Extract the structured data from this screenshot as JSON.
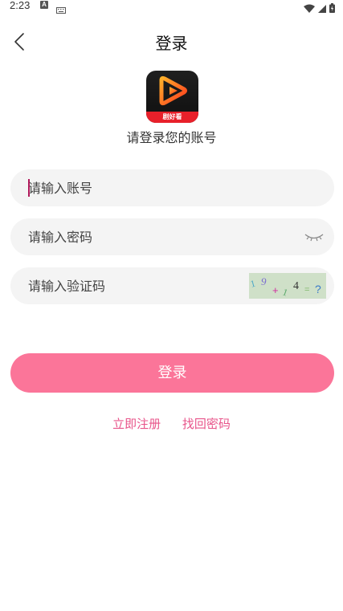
{
  "status_bar": {
    "time": "2:23",
    "a_badge": "A"
  },
  "header": {
    "title": "登录",
    "back_icon": "chevron-left-icon"
  },
  "app": {
    "logo_caption": "剧好看",
    "subtitle": "请登录您的账号"
  },
  "form": {
    "account_placeholder": "请输入账号",
    "password_placeholder": "请输入密码",
    "captcha_placeholder": "请输入验证码",
    "captcha_text": {
      "d1": "1",
      "d2": "9",
      "op": "+",
      "d3": "1",
      "d4": "4",
      "eq": "=",
      "q": "?"
    },
    "eye_icon": "eye-closed-icon"
  },
  "actions": {
    "login_label": "登录",
    "register_label": "立即注册",
    "forgot_label": "找回密码"
  },
  "colors": {
    "accent": "#fb7599",
    "link": "#e8548a",
    "field_bg": "#f4f4f4",
    "logo_red": "#e8202a"
  }
}
